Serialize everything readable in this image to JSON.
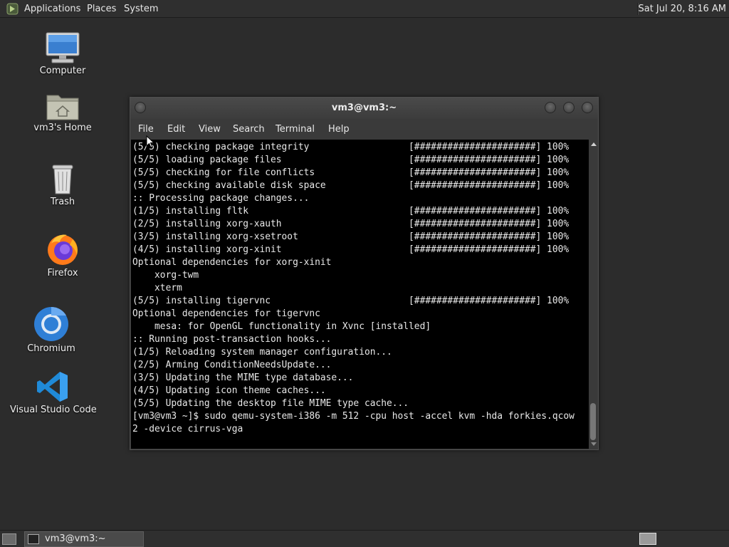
{
  "top_panel": {
    "menus": [
      "Applications",
      "Places",
      "System"
    ],
    "clock": "Sat Jul 20,  8:16 AM"
  },
  "desktop_icons": [
    {
      "label": "Computer",
      "icon": "computer-icon"
    },
    {
      "label": "vm3's Home",
      "icon": "home-folder-icon"
    },
    {
      "label": "Trash",
      "icon": "trash-icon"
    },
    {
      "label": "Firefox",
      "icon": "firefox-icon"
    },
    {
      "label": "Chromium",
      "icon": "chromium-icon"
    },
    {
      "label": "Visual Studio Code",
      "icon": "vscode-icon"
    }
  ],
  "window": {
    "title": "vm3@vm3:~",
    "menus": [
      "File",
      "Edit",
      "View",
      "Search",
      "Terminal",
      "Help"
    ],
    "terminal_lines": [
      "(5/5) checking package integrity                  [######################] 100%",
      "(5/5) loading package files                       [######################] 100%",
      "(5/5) checking for file conflicts                 [######################] 100%",
      "(5/5) checking available disk space               [######################] 100%",
      ":: Processing package changes...",
      "(1/5) installing fltk                             [######################] 100%",
      "(2/5) installing xorg-xauth                       [######################] 100%",
      "(3/5) installing xorg-xsetroot                    [######################] 100%",
      "(4/5) installing xorg-xinit                       [######################] 100%",
      "Optional dependencies for xorg-xinit",
      "    xorg-twm",
      "    xterm",
      "(5/5) installing tigervnc                         [######################] 100%",
      "Optional dependencies for tigervnc",
      "    mesa: for OpenGL functionality in Xvnc [installed]",
      ":: Running post-transaction hooks...",
      "(1/5) Reloading system manager configuration...",
      "(2/5) Arming ConditionNeedsUpdate...",
      "(3/5) Updating the MIME type database...",
      "(4/5) Updating icon theme caches...",
      "(5/5) Updating the desktop file MIME type cache...",
      "[vm3@vm3 ~]$ sudo qemu-system-i386 -m 512 -cpu host -accel kvm -hda forkies.qcow",
      "2 -device cirrus-vga"
    ]
  },
  "taskbar": {
    "task_label": "vm3@vm3:~"
  }
}
